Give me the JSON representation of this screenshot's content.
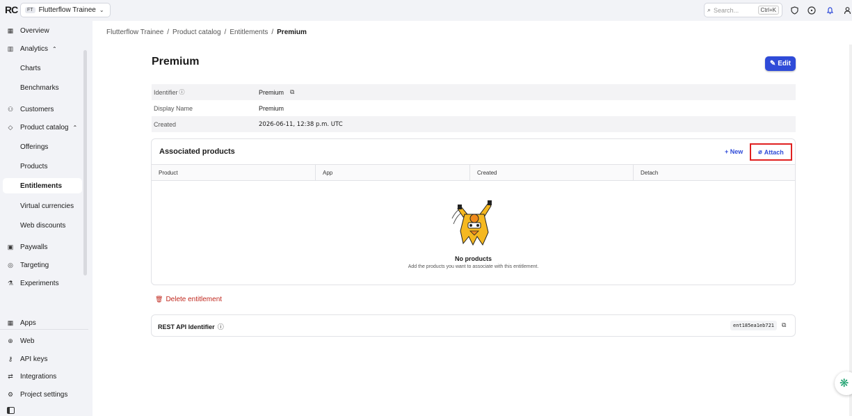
{
  "topbar": {
    "logo": "RC",
    "project_badge": "FT",
    "project_name": "Flutterflow Trainee",
    "search_placeholder": "Search...",
    "search_shortcut": "Ctrl+K"
  },
  "sidebar": {
    "items": [
      {
        "label": "Overview",
        "icon": "grid-icon"
      },
      {
        "label": "Analytics",
        "icon": "bar-chart-icon"
      },
      {
        "label": "Charts"
      },
      {
        "label": "Benchmarks"
      },
      {
        "label": "Customers",
        "icon": "user-icon"
      },
      {
        "label": "Product catalog",
        "icon": "tag-icon"
      },
      {
        "label": "Offerings"
      },
      {
        "label": "Products"
      },
      {
        "label": "Entitlements"
      },
      {
        "label": "Virtual currencies"
      },
      {
        "label": "Web discounts"
      },
      {
        "label": "Paywalls",
        "icon": "paywall-icon"
      },
      {
        "label": "Targeting",
        "icon": "target-icon"
      },
      {
        "label": "Experiments",
        "icon": "flask-icon"
      },
      {
        "label": "Apps",
        "icon": "apps-icon"
      },
      {
        "label": "Web",
        "icon": "globe-icon"
      },
      {
        "label": "API keys",
        "icon": "key-icon"
      },
      {
        "label": "Integrations",
        "icon": "integrations-icon"
      },
      {
        "label": "Project settings",
        "icon": "settings-icon"
      }
    ]
  },
  "breadcrumb": {
    "items": [
      "Flutterflow Trainee",
      "Product catalog",
      "Entitlements"
    ],
    "current": "Premium",
    "separator": "/"
  },
  "page": {
    "title": "Premium",
    "edit_label": "Edit"
  },
  "details": {
    "rows": [
      {
        "key": "Identifier",
        "value": "Premium"
      },
      {
        "key": "Display Name",
        "value": "Premium"
      },
      {
        "key": "Created",
        "value": "2026-06-11, 12:38 p.m. UTC"
      }
    ]
  },
  "associated_products": {
    "title": "Associated products",
    "new_label": "+ New",
    "attach_label": "Attach",
    "columns": [
      "Product",
      "App",
      "Created",
      "Detach"
    ],
    "empty_title": "No products",
    "empty_subtitle": "Add the products you want to associate with this entitlement."
  },
  "delete_label": "Delete entitlement",
  "api": {
    "title": "REST API Identifier",
    "identifier": "ent185ea1eb721"
  },
  "colors": {
    "accent": "#2f4bd8",
    "danger": "#c0281e",
    "highlight_box": "#e02020",
    "sidebar_bg": "#f2f3f7"
  }
}
